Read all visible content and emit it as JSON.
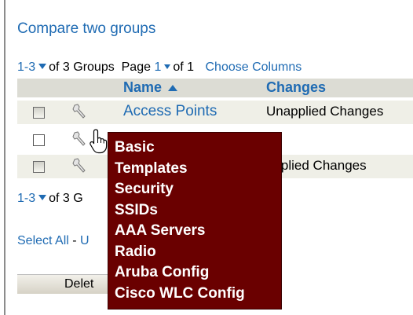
{
  "compare_link": "Compare two groups",
  "pager_top": {
    "range": "1-3",
    "of_groups": "of 3 Groups",
    "page_label": "Page",
    "page": "1",
    "of_pages": "of 1",
    "choose_columns": "Choose Columns"
  },
  "table": {
    "headers": {
      "name": "Name",
      "changes": "Changes"
    },
    "rows": [
      {
        "name": "Access Points",
        "changes": "Unapplied Changes"
      },
      {
        "name": "",
        "changes": ""
      },
      {
        "name": "",
        "changes": "applied Changes"
      }
    ]
  },
  "pager_bottom": {
    "range": "1-3",
    "of_groups": "of 3 G"
  },
  "select_links": {
    "select_all": "Select All",
    "separator": " - ",
    "partial": "U"
  },
  "delete_button": "Delet",
  "context_menu": [
    "Basic",
    "Templates",
    "Security",
    "SSIDs",
    "AAA Servers",
    "Radio",
    "Aruba Config",
    "Cisco WLC Config"
  ],
  "colors": {
    "link": "#1f6bb3",
    "menu_bg": "#6a0000",
    "header_bg": "#dcdcd4",
    "row_alt": "#efefe7"
  }
}
